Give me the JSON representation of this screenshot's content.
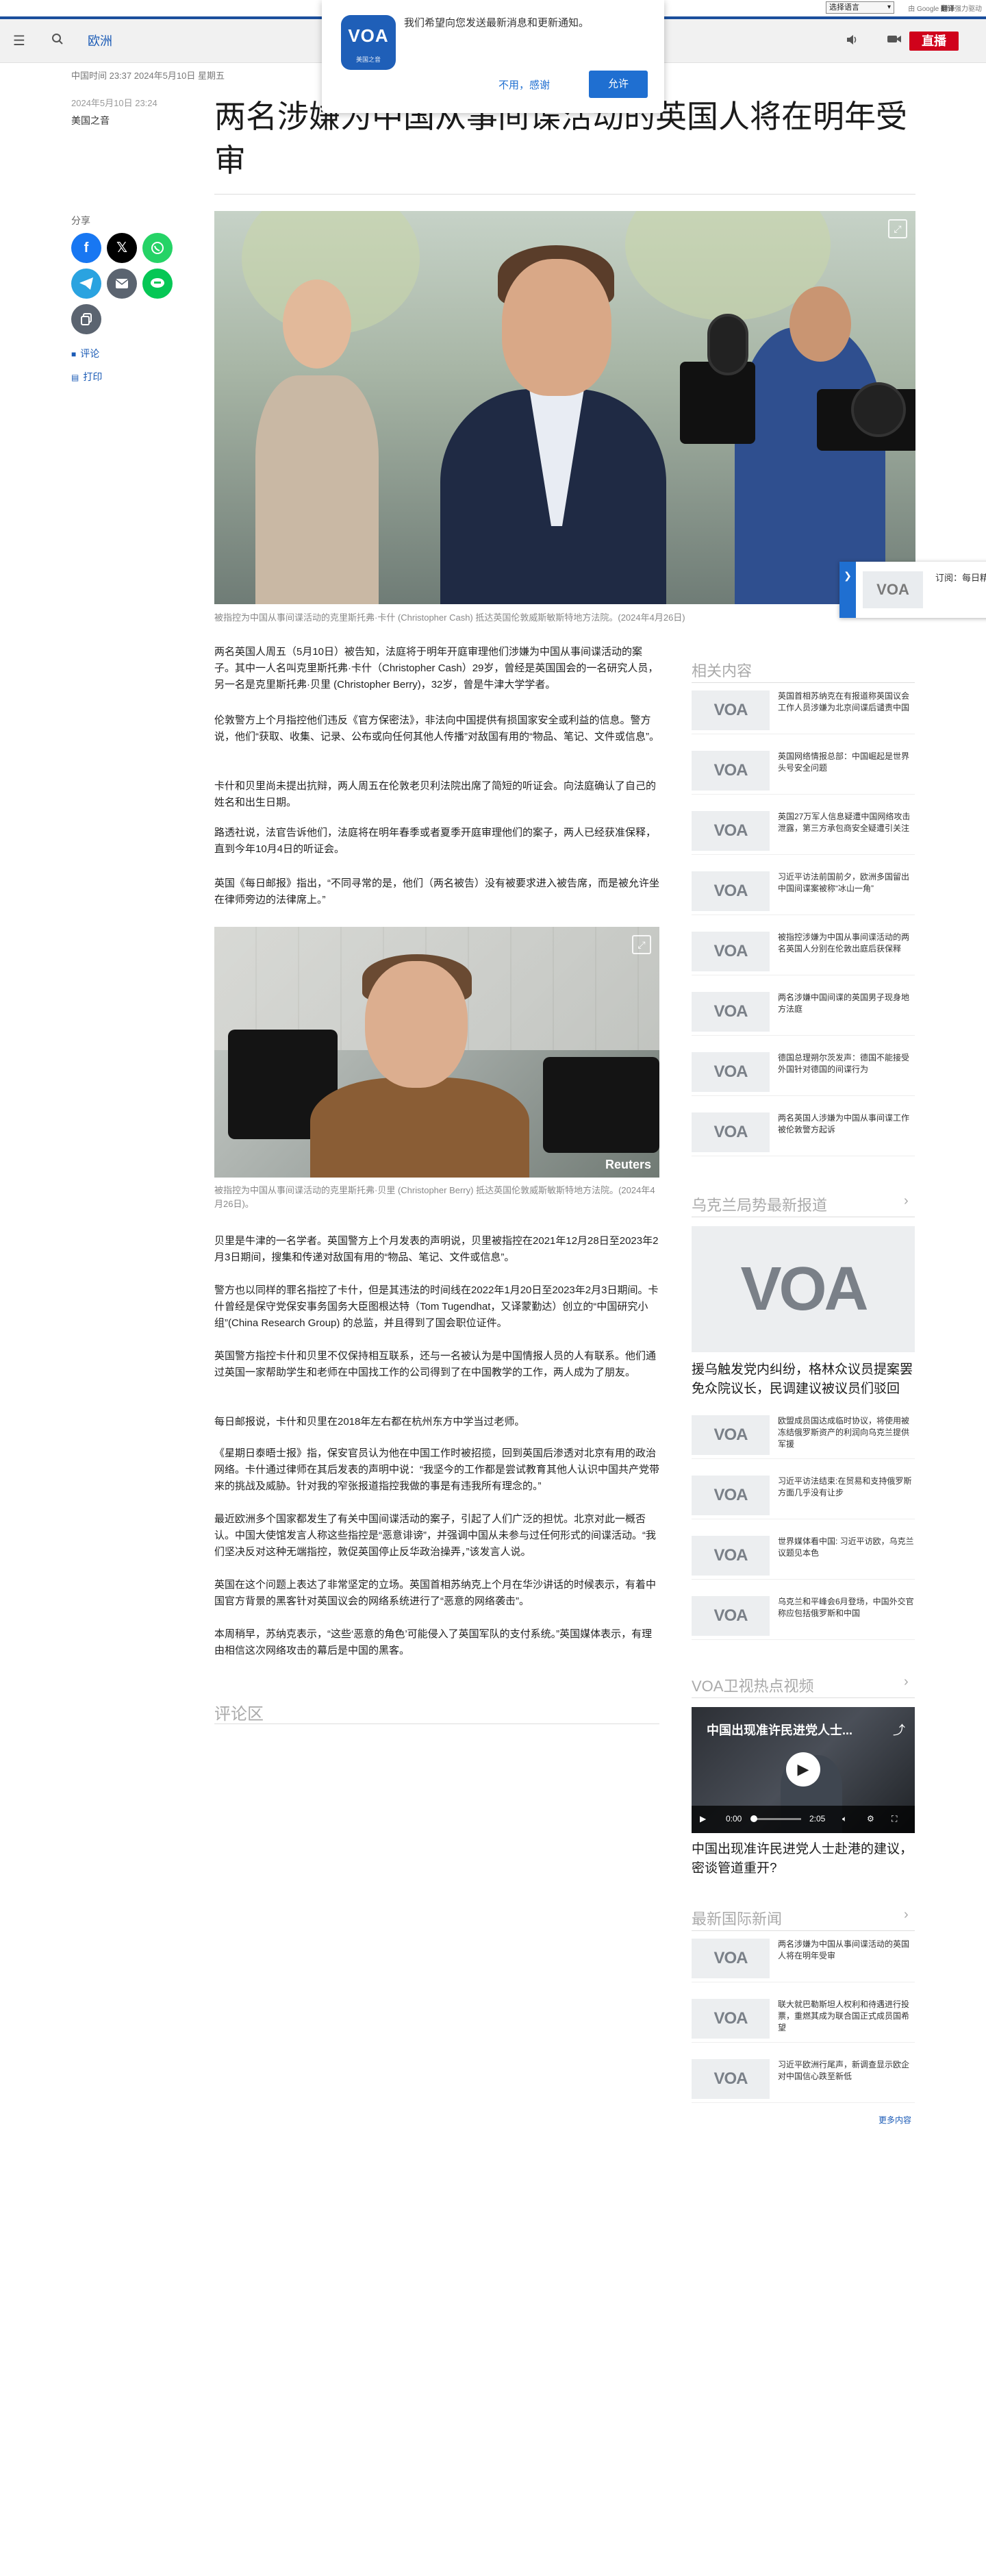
{
  "utility": {
    "language_select": "选择语言",
    "powered_prefix": "由 Google",
    "powered_brand": "翻译",
    "powered_suffix": "强力驱动"
  },
  "nav": {
    "section": "欧洲",
    "live": "直播"
  },
  "notification": {
    "logo_text": "VOA",
    "logo_sub": "美国之音",
    "message": "我们希望向您发送最新消息和更新通知。",
    "decline": "不用，感谢",
    "accept": "允许"
  },
  "article": {
    "datetime": "中国时间 23:37 2024年5月10日 星期五",
    "datetime2": "2024年5月10日 23:24",
    "byline": "美国之音",
    "headline": "两名涉嫌为中国从事间谍活动的英国人将在明年受审",
    "share_label": "分享",
    "comment_link": "评论",
    "print_link": "打印",
    "image1_caption": "被指控为中国从事间谍活动的克里斯托弗·卡什 (Christopher Cash) 抵达英国伦敦威斯敏斯特地方法院。(2024年4月26日)",
    "image2_caption": "被指控为中国从事间谍活动的克里斯托弗·贝里 (Christopher Berry) 抵达英国伦敦威斯敏斯特地方法院。(2024年4月26日)。",
    "image2_credit": "Reuters",
    "paragraphs_top": [
      "两名英国人周五（5月10日）被告知，法庭将于明年开庭审理他们涉嫌为中国从事间谍活动的案子。其中一人名叫克里斯托弗·卡什（Christopher Cash）29岁，曾经是英国国会的一名研究人员，另一名是克里斯托弗·贝里 (Christopher Berry)，32岁，曾是牛津大学学者。",
      "伦敦警方上个月指控他们违反《官方保密法》，非法向中国提供有损国家安全或利益的信息。警方说，他们“获取、收集、记录、公布或向任何其他人传播”对敌国有用的“物品、笔记、文件或信息”。",
      "卡什和贝里尚未提出抗辩，两人周五在伦敦老贝利法院出席了简短的听证会。向法庭确认了自己的姓名和出生日期。",
      "路透社说，法官告诉他们，法庭将在明年春季或者夏季开庭审理他们的案子，两人已经获准保释，直到今年10月4日的听证会。",
      "英国《每日邮报》指出，“不同寻常的是，他们（两名被告）没有被要求进入被告席，而是被允许坐在律师旁边的法律席上。”"
    ],
    "paragraphs_bottom": [
      "贝里是牛津的一名学者。英国警方上个月发表的声明说，贝里被指控在2021年12月28日至2023年2月3日期间，搜集和传递对敌国有用的“物品、笔记、文件或信息”。",
      "警方也以同样的罪名指控了卡什，但是其违法的时间线在2022年1月20日至2023年2月3日期间。卡什曾经是保守党保安事务国务大臣图根达特（Tom Tugendhat，又译蒙勤达）创立的“中国研究小组”(China Research Group) 的总监，并且得到了国会职位证件。",
      "英国警方指控卡什和贝里不仅保持相互联系，还与一名被认为是中国情报人员的人有联系。他们通过英国一家帮助学生和老师在中国找工作的公司得到了在中国教学的工作，两人成为了朋友。",
      "每日邮报说，卡什和贝里在2018年左右都在杭州东方中学当过老师。",
      "《星期日泰晤士报》指，保安官员认为他在中国工作时被招揽，回到英国后渗透对北京有用的政治网络。卡什通过律师在其后发表的声明中说：“我坚今的工作都是尝试教育其他人认识中国共产党带来的挑战及威胁。针对我的窄张报道指控我做的事是有违我所有理念的。”",
      "最近欧洲多个国家都发生了有关中国间谍活动的案子，引起了人们广泛的担忧。北京对此一概否认。中国大使馆发言人称这些指控是“恶意诽谤”，并强调中国从未参与过任何形式的间谍活动。“我们坚决反对这种无端指控，敦促英国停止反华政治操弄，”该发言人说。",
      "英国在这个问题上表达了非常坚定的立场。英国首相苏纳克上个月在华沙讲话的时候表示，有着中国官方背景的黑客针对英国议会的网络系统进行了“恶意的网络袭击”。",
      "本周稍早，苏纳克表示，“这些‘恶意的角色’可能侵入了英国军队的支付系统。”英国媒体表示，有理由相信这次网络攻击的幕后是中国的黑客。"
    ],
    "comments_title": "评论区"
  },
  "subscribe": {
    "tab_icon": "arrow-icon",
    "text": "订阅：每日精选 / 时政要闻 / 特别法律窗口"
  },
  "sidebar": {
    "related_title": "相关内容",
    "related": [
      "英国首相苏纳克在有报道称英国议会工作人员涉嫌为北京间谍后谴责中国",
      "英国网络情报总部：中国崛起是世界头号安全问题",
      "英国27万军人信息疑遭中国网络攻击泄露，第三方承包商安全疑遭引关注",
      "习近平访法前国前夕，欧洲多国留出中国间谍案被称“冰山一角”",
      "被指控涉嫌为中国从事间谍活动的两名英国人分别在伦敦出庭后获保释",
      "两名涉嫌中国间谍的英国男子现身地方法庭",
      "德国总理朔尔茨发声：德国不能接受外国针对德国的间谍行为",
      "两名英国人涉嫌为中国从事间谍工作被伦敦警方起诉"
    ],
    "ukraine_title": "乌克兰局势最新报道",
    "ukraine_headline": "援乌触发党内纠纷，格林众议员提案罢免众院议长，民调建议被议员们驳回",
    "ukraine": [
      "欧盟成员国达成临时协议，将使用被冻结俄罗斯资产的利润向乌克兰提供军援",
      "习近平访法结束:在贸易和支持俄罗斯方面几乎没有让步",
      "世界媒体看中国: 习近平访欧，乌克兰议题见本色",
      "乌克兰和平峰会6月登场，中国外交官称应包括俄罗斯和中国"
    ],
    "video_section_title": "VOA卫视热点视频",
    "video_overlay_title": "中国出现准许民进党人士...",
    "video_time": "0:00",
    "video_duration": "2:05",
    "video_headline": "中国出现准许民进党人士赴港的建议，密谈管道重开?",
    "intl_title": "最新国际新闻",
    "intl": [
      "两名涉嫌为中国从事间谍活动的英国人将在明年受审",
      "联大就巴勒斯坦人权利和待遇进行投票，重燃其成为联合国正式成员国希望",
      "习近平欧洲行尾声，新调查显示欧企对中国信心跌至新低"
    ],
    "more": "更多内容",
    "thumb_text": "VOA"
  },
  "colors": {
    "brand_blue": "#1f6fd1",
    "live_red": "#d0021b",
    "facebook": "#1877f2",
    "x": "#000000",
    "whatsapp": "#25d366",
    "telegram": "#2aa3e0",
    "email": "#5b6470",
    "line": "#06c755",
    "copy": "#5b6470"
  }
}
